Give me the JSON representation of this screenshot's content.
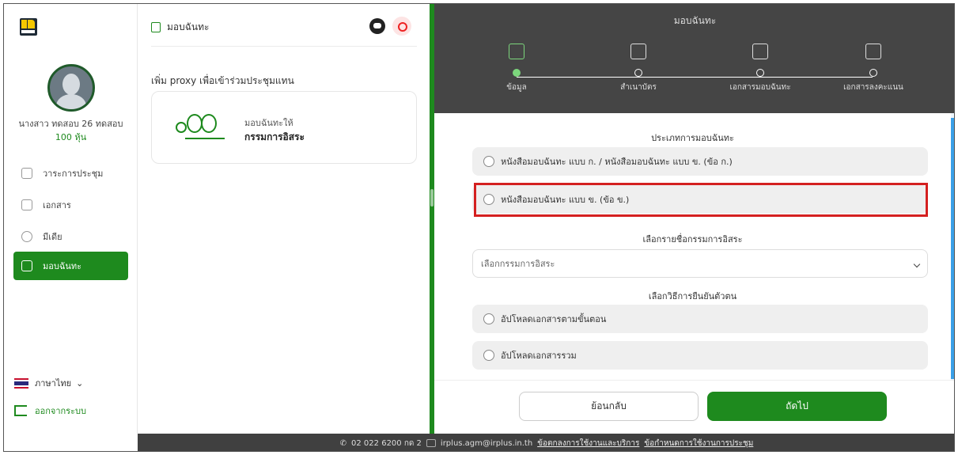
{
  "sidebar": {
    "user_name": "นางสาว ทดสอบ 26 ทดสอบ",
    "user_shares": "100 หุ้น",
    "items": [
      {
        "label": "วาระการประชุม",
        "icon": "agenda-icon"
      },
      {
        "label": "เอกสาร",
        "icon": "folder-icon"
      },
      {
        "label": "มีเดีย",
        "icon": "media-icon"
      },
      {
        "label": "มอบฉันทะ",
        "icon": "proxy-doc-icon",
        "active": true
      }
    ],
    "language": "ภาษาไทย",
    "logout": "ออกจากระบบ"
  },
  "middle": {
    "header": "มอบฉันทะ",
    "proxy_title": "เพิ่ม proxy เพื่อเข้าร่วมประชุมแทน",
    "card_small": "มอบฉันทะให้",
    "card_big": "กรรมการอิสระ"
  },
  "right": {
    "title": "มอบฉันทะ",
    "steps": [
      {
        "label": "ข้อมูล",
        "active": true,
        "icon": "clipboard-icon"
      },
      {
        "label": "สำเนาบัตร",
        "active": false,
        "icon": "id-card-icon"
      },
      {
        "label": "เอกสารมอบฉันทะ",
        "active": false,
        "icon": "proxy-form-icon"
      },
      {
        "label": "เอกสารลงคะแนน",
        "active": false,
        "icon": "vote-icon"
      }
    ],
    "type_title": "ประเภทการมอบฉันทะ",
    "type_options": [
      "หนังสือมอบฉันทะ แบบ ก. / หนังสือมอบฉันทะ แบบ ข. (ข้อ ก.)",
      "หนังสือมอบฉันทะ แบบ ข. (ข้อ ข.)"
    ],
    "director_title": "เลือกรายชื่อกรรมการอิสระ",
    "director_placeholder": "เลือกกรรมการอิสระ",
    "verify_title": "เลือกวิธีการยืนยันตัวตน",
    "verify_options": [
      "อัปโหลดเอกสารตามขั้นตอน",
      "อัปโหลดเอกสารรวม"
    ],
    "back_label": "ย้อนกลับ",
    "next_label": "ถัดไป"
  },
  "footer": {
    "phone": "02 022 6200 กด 2",
    "email": "irplus.agm@irplus.in.th",
    "link1": "ข้อตกลงการใช้งานและบริการ",
    "link2": "ข้อกำหนดการใช้งานการประชุม"
  },
  "colors": {
    "accent": "#1e8a1e",
    "header_bg": "#454545",
    "highlight": "#d42020"
  }
}
